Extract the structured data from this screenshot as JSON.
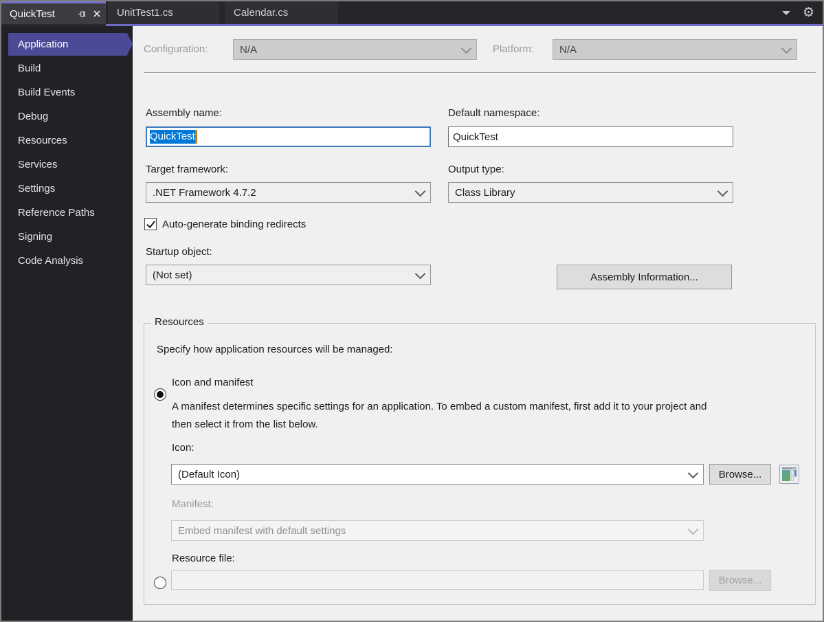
{
  "tabs": [
    {
      "label": "QuickTest",
      "active": true
    },
    {
      "label": "UnitTest1.cs",
      "active": false
    },
    {
      "label": "Calendar.cs",
      "active": false
    }
  ],
  "sidebar": {
    "items": [
      {
        "label": "Application",
        "selected": true
      },
      {
        "label": "Build",
        "selected": false
      },
      {
        "label": "Build Events",
        "selected": false
      },
      {
        "label": "Debug",
        "selected": false
      },
      {
        "label": "Resources",
        "selected": false
      },
      {
        "label": "Services",
        "selected": false
      },
      {
        "label": "Settings",
        "selected": false
      },
      {
        "label": "Reference Paths",
        "selected": false
      },
      {
        "label": "Signing",
        "selected": false
      },
      {
        "label": "Code Analysis",
        "selected": false
      }
    ]
  },
  "config_row": {
    "configuration_label": "Configuration:",
    "configuration_value": "N/A",
    "platform_label": "Platform:",
    "platform_value": "N/A"
  },
  "form": {
    "assembly_name_label": "Assembly name:",
    "assembly_name_value": "QuickTest",
    "assembly_name_selected": true,
    "default_namespace_label": "Default namespace:",
    "default_namespace_value": "QuickTest",
    "target_framework_label": "Target framework:",
    "target_framework_value": ".NET Framework 4.7.2",
    "output_type_label": "Output type:",
    "output_type_value": "Class Library",
    "auto_generate_binding_redirects_label": "Auto-generate binding redirects",
    "auto_generate_checked": true,
    "startup_object_label": "Startup object:",
    "startup_object_value": "(Not set)",
    "assembly_information_button": "Assembly Information..."
  },
  "resources_group": {
    "legend": "Resources",
    "intro": "Specify how application resources will be managed:",
    "icon_and_manifest_label": "Icon and manifest",
    "icon_and_manifest_selected": true,
    "manifest_description": "A manifest determines specific settings for an application. To embed a custom manifest, first add it to your project and then select it from the list below.",
    "icon_label": "Icon:",
    "icon_value": "(Default Icon)",
    "browse_button": "Browse...",
    "icon_preview": "default-application-icon",
    "manifest_label": "Manifest:",
    "manifest_value": "Embed manifest with default settings",
    "resource_file_label": "Resource file:",
    "resource_file_value": "",
    "resource_file_selected": false,
    "resource_browse_button": "Browse..."
  },
  "icons": {
    "gear_glyph": "⚙",
    "pin": "pin-icon",
    "close": "close-icon",
    "tab_overflow": "chevron-down-icon"
  },
  "colors": {
    "accent_purple": "#6f6cc9",
    "active_tab_top": "#7672cf",
    "sidebar_selection": "#4b4a97",
    "sidebar_bg": "#222226",
    "tabbar_bg": "#26262a",
    "content_bg": "#f0f0f0",
    "selection_blue": "#0078d7",
    "focus_border": "#3b79bd",
    "caret_orange": "#c97e0a"
  }
}
